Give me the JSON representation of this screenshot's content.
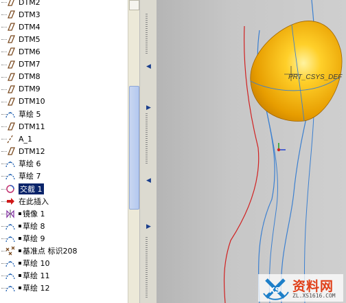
{
  "tree": {
    "items": [
      {
        "icon": "datum-plane-icon",
        "label": "DTM2",
        "bullet": false,
        "selected": false
      },
      {
        "icon": "datum-plane-icon",
        "label": "DTM3",
        "bullet": false,
        "selected": false
      },
      {
        "icon": "datum-plane-icon",
        "label": "DTM4",
        "bullet": false,
        "selected": false
      },
      {
        "icon": "datum-plane-icon",
        "label": "DTM5",
        "bullet": false,
        "selected": false
      },
      {
        "icon": "datum-plane-icon",
        "label": "DTM6",
        "bullet": false,
        "selected": false
      },
      {
        "icon": "datum-plane-icon",
        "label": "DTM7",
        "bullet": false,
        "selected": false
      },
      {
        "icon": "datum-plane-icon",
        "label": "DTM8",
        "bullet": false,
        "selected": false
      },
      {
        "icon": "datum-plane-icon",
        "label": "DTM9",
        "bullet": false,
        "selected": false
      },
      {
        "icon": "datum-plane-icon",
        "label": "DTM10",
        "bullet": false,
        "selected": false
      },
      {
        "icon": "sketch-icon",
        "label": "草绘 5",
        "bullet": false,
        "selected": false
      },
      {
        "icon": "datum-plane-icon",
        "label": "DTM11",
        "bullet": false,
        "selected": false
      },
      {
        "icon": "datum-axis-icon",
        "label": "A_1",
        "bullet": false,
        "selected": false
      },
      {
        "icon": "datum-plane-icon",
        "label": "DTM12",
        "bullet": false,
        "selected": false
      },
      {
        "icon": "sketch-icon",
        "label": "草绘 6",
        "bullet": false,
        "selected": false
      },
      {
        "icon": "sketch-icon",
        "label": "草绘 7",
        "bullet": false,
        "selected": false
      },
      {
        "icon": "intersect-icon",
        "label": "交截 1",
        "bullet": false,
        "selected": true
      },
      {
        "icon": "insert-here-arrow-icon",
        "label": "在此插入",
        "bullet": false,
        "selected": false
      },
      {
        "icon": "mirror-icon",
        "label": "镜像 1",
        "bullet": true,
        "selected": false
      },
      {
        "icon": "sketch-icon",
        "label": "草绘 8",
        "bullet": true,
        "selected": false
      },
      {
        "icon": "sketch-icon",
        "label": "草绘 9",
        "bullet": true,
        "selected": false
      },
      {
        "icon": "datum-point-icon",
        "label": "基准点 标识208",
        "bullet": true,
        "selected": false
      },
      {
        "icon": "sketch-icon",
        "label": "草绘 10",
        "bullet": true,
        "selected": false
      },
      {
        "icon": "sketch-icon",
        "label": "草绘 11",
        "bullet": true,
        "selected": false
      },
      {
        "icon": "sketch-icon",
        "label": "草绘 12",
        "bullet": true,
        "selected": false
      }
    ]
  },
  "viewport": {
    "csys_label": "PRT_CSYS_DEF",
    "colors": {
      "surface": "#f2b400",
      "curve_blue": "#3a7fd0",
      "curve_red": "#d02020"
    }
  },
  "watermark": {
    "brand": "资料网",
    "url": "ZL.XS1616.COM",
    "logo_text": "XS"
  }
}
